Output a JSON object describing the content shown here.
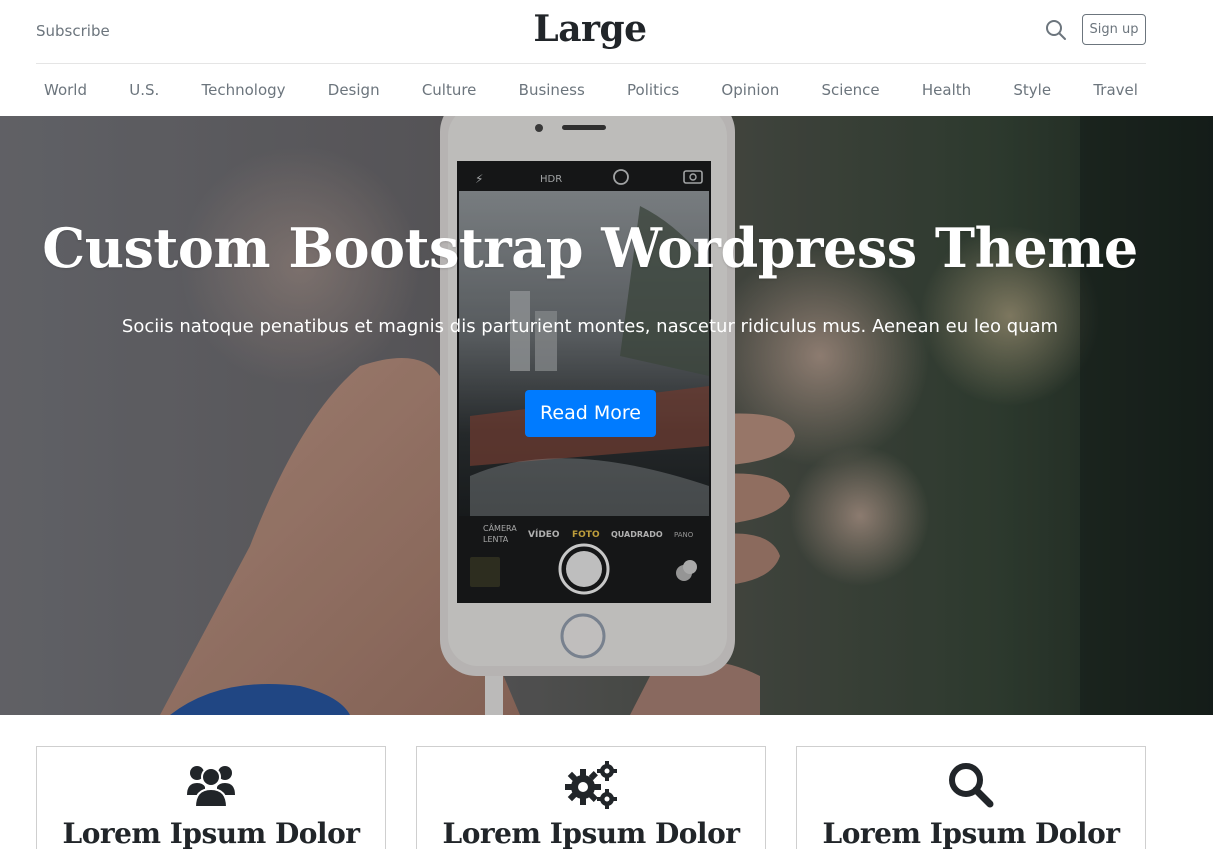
{
  "header": {
    "subscribe_label": "Subscribe",
    "brand": "Large",
    "search_icon": "search-icon",
    "signup_label": "Sign up"
  },
  "nav": {
    "items": [
      "World",
      "U.S.",
      "Technology",
      "Design",
      "Culture",
      "Business",
      "Politics",
      "Opinion",
      "Science",
      "Health",
      "Style",
      "Travel"
    ]
  },
  "hero": {
    "title": "Custom Bootstrap Wordpress Theme",
    "lead": "Sociis natoque penatibus et magnis dis parturient montes, nascetur ridiculus mus. Aenean eu leo quam",
    "button_label": "Read More",
    "button_color": "#007bff",
    "phone_ui": {
      "modes": [
        "CÂMERA LENTA",
        "VÍDEO",
        "FOTO",
        "QUADRADO",
        "PANO"
      ]
    }
  },
  "features": [
    {
      "icon": "users-icon",
      "title": "Lorem Ipsum Dolor"
    },
    {
      "icon": "gears-icon",
      "title": "Lorem Ipsum Dolor"
    },
    {
      "icon": "search-icon",
      "title": "Lorem Ipsum Dolor"
    }
  ]
}
